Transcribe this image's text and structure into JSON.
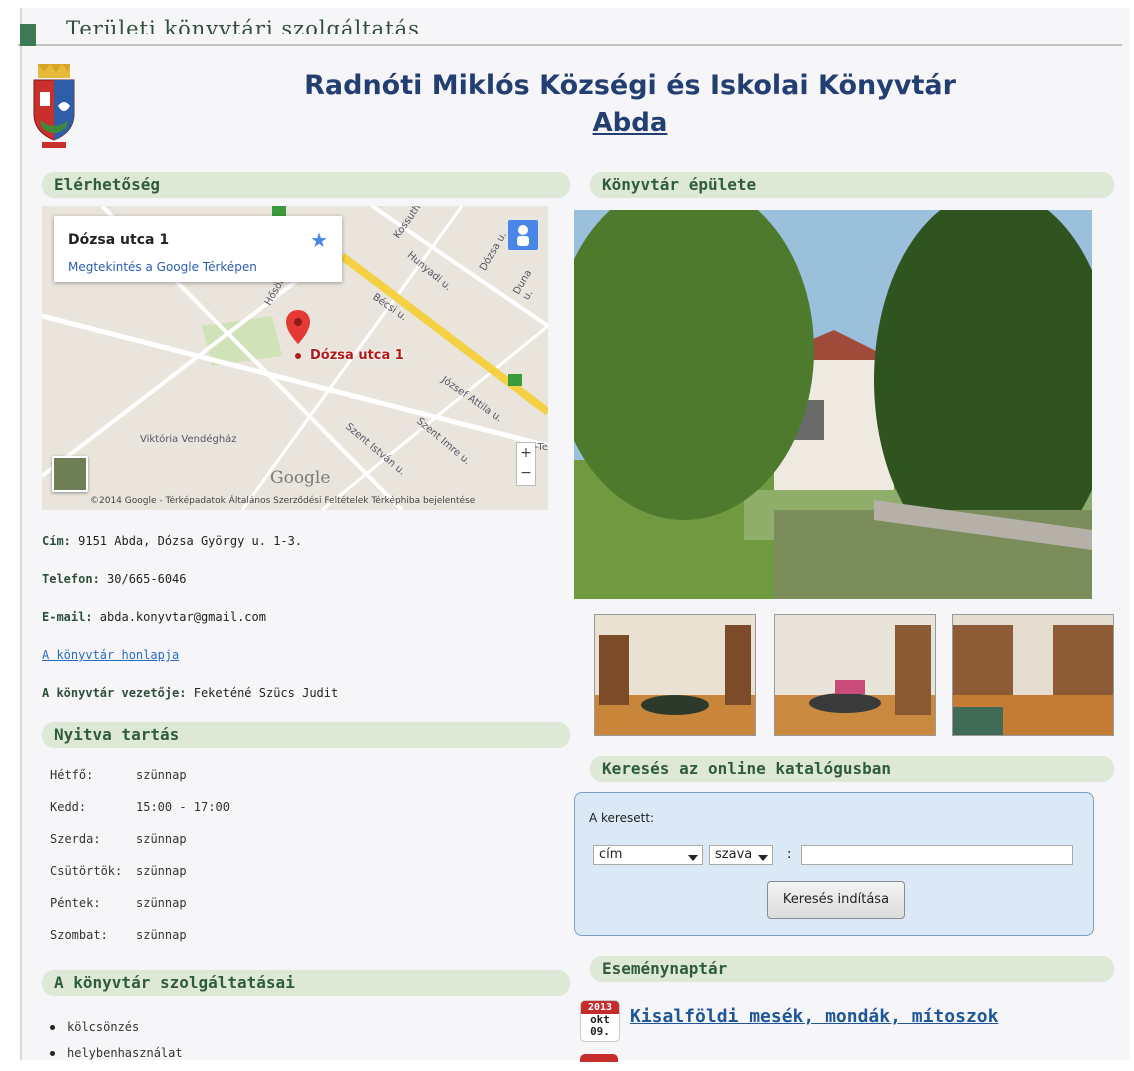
{
  "header": {
    "section_title": "Területi könyvtári szolgáltatás"
  },
  "library": {
    "name": "Radnóti Miklós Községi és Iskolai Könyvtár",
    "city": "Abda"
  },
  "contact": {
    "heading": "Elérhetőség",
    "map": {
      "card_address": "Dózsa utca 1",
      "card_link": "Megtekintés a Google Térképen",
      "pin_label": "Dózsa utca 1",
      "streets": [
        "Bécsi u.",
        "Hunyadi u.",
        "Dózsa u.",
        "József Attila u.",
        "Szent Imre u.",
        "Szent István u.",
        "Kossuth",
        "Duna u.",
        "Hősök"
      ],
      "poi": "Viktória Vendégház",
      "logo": "Google",
      "attribution": "©2014 Google - Térképadatok   Általános Szerződési Feltételek   Térképhiba bejelentése",
      "zoom_in": "+",
      "zoom_out": "−",
      "edge_label": "-Te"
    },
    "address_label": "Cím:",
    "address": " 9151 Abda, Dózsa György u. 1-3.",
    "phone_label": "Telefon:",
    "phone": " 30/665-6046",
    "email_label": "E-mail:",
    "email": " abda.konyvtar@gmail.com",
    "homepage_link": "A könyvtár honlapja",
    "manager_label": "A könyvtár vezetője:",
    "manager": " Feketéné Szücs Judit"
  },
  "hours": {
    "heading": "Nyitva tartás",
    "rows": [
      {
        "day": "Hétfő:",
        "time": "szünnap"
      },
      {
        "day": "Kedd:",
        "time": "15:00 - 17:00"
      },
      {
        "day": "Szerda:",
        "time": "szünnap"
      },
      {
        "day": "Csütörtök:",
        "time": "szünnap"
      },
      {
        "day": "Péntek:",
        "time": "szünnap"
      },
      {
        "day": "Szombat:",
        "time": "szünnap"
      }
    ]
  },
  "services": {
    "heading": "A könyvtár szolgáltatásai",
    "items": [
      "kölcsönzés",
      "helybenhasználat"
    ]
  },
  "building": {
    "heading": "Könyvtár épülete"
  },
  "catalog": {
    "heading": "Keresés az online katalógusban",
    "label": "A keresett:",
    "field_select": "cím",
    "mode_select": "szava",
    "colon": ":",
    "button": "Keresés indítása"
  },
  "events": {
    "heading": "Eseménynaptár",
    "items": [
      {
        "year": "2013",
        "month": "okt",
        "day": "09.",
        "title": "Kisalföldi mesék, mondák, mítoszok"
      }
    ]
  },
  "colors": {
    "title_blue": "#233f72",
    "header_green": "#dde8d6",
    "search_panel": "#dbe8f5"
  }
}
